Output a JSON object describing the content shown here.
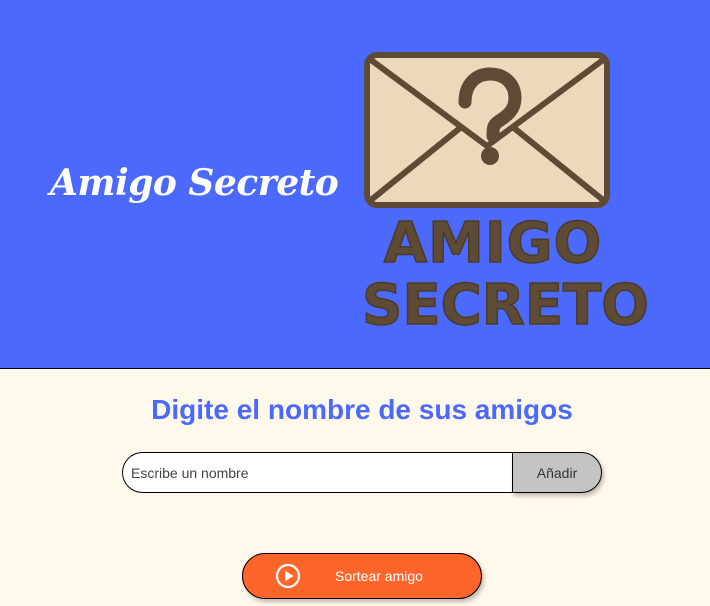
{
  "header": {
    "title": "Amigo Secreto",
    "logo": {
      "icon": "envelope-question-icon",
      "line1": "AMIGO",
      "line2": "SECRETO"
    }
  },
  "main": {
    "heading": "Digite el nombre de sus amigos",
    "name_input": {
      "value": "",
      "placeholder": "Escribe un nombre"
    },
    "add_button": {
      "label": "Añadir"
    },
    "draw_button": {
      "label": "Sortear amigo",
      "icon": "play-circle-icon"
    }
  },
  "colors": {
    "header_bg": "#4B69FD",
    "page_bg": "#FFF9EB",
    "accent": "#4B69FD",
    "draw_button": "#FE652B",
    "add_button": "#C4C4C4",
    "logo_brown": "#5E4B36",
    "envelope_fill": "#EBD9BC"
  }
}
